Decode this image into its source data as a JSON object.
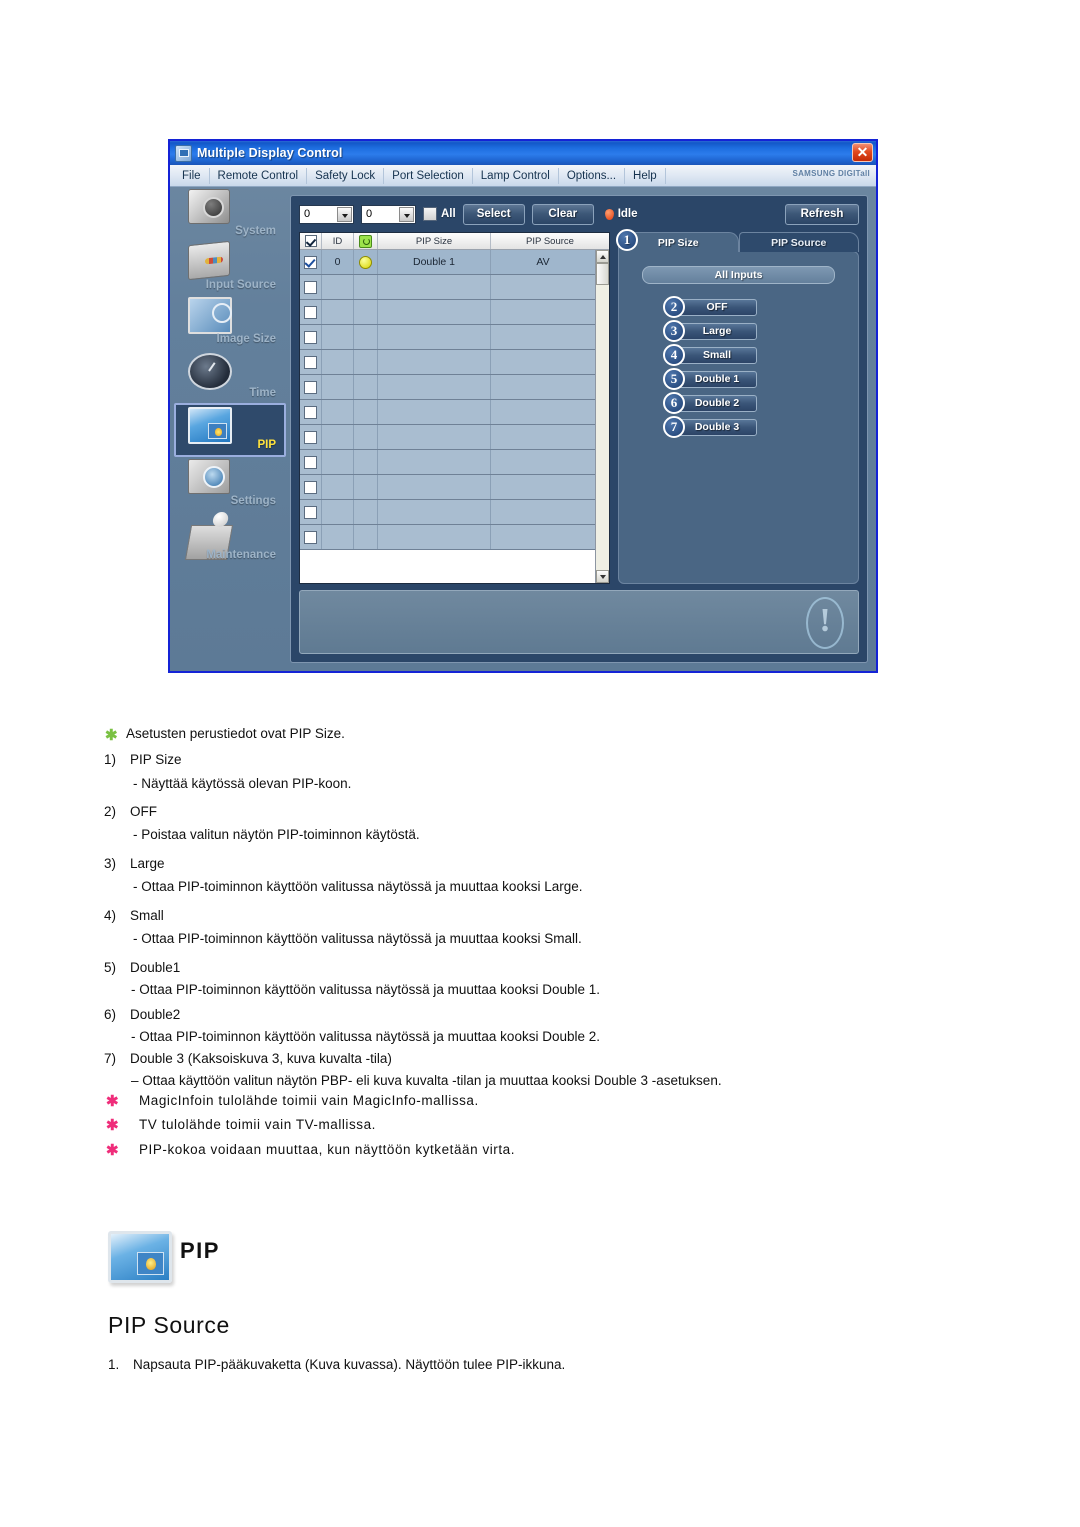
{
  "app": {
    "title": "Multiple Display Control",
    "close_label": "✕",
    "brand": "SAMSUNG DIGITall",
    "menu": [
      "File",
      "Remote Control",
      "Safety Lock",
      "Port Selection",
      "Lamp Control",
      "Options...",
      "Help"
    ],
    "sidebar": {
      "items": [
        {
          "label": "System",
          "icon": "system-icon",
          "selected": false
        },
        {
          "label": "Input Source",
          "icon": "input-source-icon",
          "selected": false
        },
        {
          "label": "Image Size",
          "icon": "image-size-icon",
          "selected": false
        },
        {
          "label": "Time",
          "icon": "time-icon",
          "selected": false
        },
        {
          "label": "PIP",
          "icon": "pip-icon",
          "selected": true
        },
        {
          "label": "Settings",
          "icon": "settings-icon",
          "selected": false
        },
        {
          "label": "Maintenance",
          "icon": "maintenance-icon",
          "selected": false
        }
      ]
    },
    "toolbar": {
      "combo_from": "0",
      "combo_to": "0",
      "all_label": "All",
      "all_checked": false,
      "select_label": "Select",
      "clear_label": "Clear",
      "status_label": "Idle",
      "status_color": "#e23a0c",
      "refresh_label": "Refresh"
    },
    "grid": {
      "columns": [
        "",
        "ID",
        "",
        "PIP Size",
        "PIP Source"
      ],
      "rows": [
        {
          "checked": true,
          "id": "0",
          "power": "on",
          "pip_size": "Double 1",
          "pip_source": "AV"
        },
        {
          "checked": false,
          "id": "",
          "power": "",
          "pip_size": "",
          "pip_source": ""
        },
        {
          "checked": false,
          "id": "",
          "power": "",
          "pip_size": "",
          "pip_source": ""
        },
        {
          "checked": false,
          "id": "",
          "power": "",
          "pip_size": "",
          "pip_source": ""
        },
        {
          "checked": false,
          "id": "",
          "power": "",
          "pip_size": "",
          "pip_source": ""
        },
        {
          "checked": false,
          "id": "",
          "power": "",
          "pip_size": "",
          "pip_source": ""
        },
        {
          "checked": false,
          "id": "",
          "power": "",
          "pip_size": "",
          "pip_source": ""
        },
        {
          "checked": false,
          "id": "",
          "power": "",
          "pip_size": "",
          "pip_source": ""
        },
        {
          "checked": false,
          "id": "",
          "power": "",
          "pip_size": "",
          "pip_source": ""
        },
        {
          "checked": false,
          "id": "",
          "power": "",
          "pip_size": "",
          "pip_source": ""
        },
        {
          "checked": false,
          "id": "",
          "power": "",
          "pip_size": "",
          "pip_source": ""
        },
        {
          "checked": false,
          "id": "",
          "power": "",
          "pip_size": "",
          "pip_source": ""
        }
      ]
    },
    "tabs": [
      {
        "label": "PIP Size",
        "active": true,
        "callout": "1"
      },
      {
        "label": "PIP Source",
        "active": false,
        "callout": ""
      }
    ],
    "panel": {
      "all_inputs_label": "All Inputs",
      "options": [
        {
          "callout": "2",
          "label": "OFF"
        },
        {
          "callout": "3",
          "label": "Large"
        },
        {
          "callout": "4",
          "label": "Small"
        },
        {
          "callout": "5",
          "label": "Double 1"
        },
        {
          "callout": "6",
          "label": "Double 2"
        },
        {
          "callout": "7",
          "label": "Double 3"
        }
      ]
    },
    "statusbar": {
      "icon": "exclamation-circle-icon"
    }
  },
  "doc": {
    "intro": "Asetusten perustiedot ovat PIP Size.",
    "items": [
      {
        "num": "1)",
        "title": "PIP Size",
        "desc": "- Näyttää käytössä olevan PIP-koon."
      },
      {
        "num": "2)",
        "title": "OFF",
        "desc": "- Poistaa valitun näytön PIP-toiminnon käytöstä."
      },
      {
        "num": "3)",
        "title": "Large",
        "desc": "- Ottaa PIP-toiminnon käyttöön valitussa näytössä ja muuttaa kooksi Large."
      },
      {
        "num": "4)",
        "title": "Small",
        "desc": "- Ottaa PIP-toiminnon käyttöön valitussa näytössä ja muuttaa kooksi Small."
      },
      {
        "num": "5)",
        "title": "Double1",
        "desc": "- Ottaa PIP-toiminnon käyttöön valitussa näytössä ja muuttaa kooksi Double 1."
      },
      {
        "num": "6)",
        "title": "Double2",
        "desc": "- Ottaa PIP-toiminnon käyttöön valitussa näytössä ja muuttaa kooksi Double 2."
      },
      {
        "num": "7)",
        "title": "Double 3 (Kaksoiskuva 3, kuva kuvalta -tila)",
        "desc": "– Ottaa käyttöön valitun näytön PBP- eli kuva kuvalta -tilan ja muuttaa kooksi Double 3 -asetuksen."
      }
    ],
    "notes": [
      "MagicInfoin tulolähde toimii vain MagicInfo-mallissa.",
      "TV tulolähde toimii vain TV-mallissa.",
      "PIP-kokoa voidaan muuttaa, kun näyttöön kytketään virta."
    ],
    "section": {
      "icon_label": "PIP",
      "title": "PIP Source",
      "step_num": "1.",
      "step_text": "Napsauta PIP-pääkuvaketta (Kuva kuvassa). Näyttöön tulee PIP-ikkuna."
    }
  }
}
